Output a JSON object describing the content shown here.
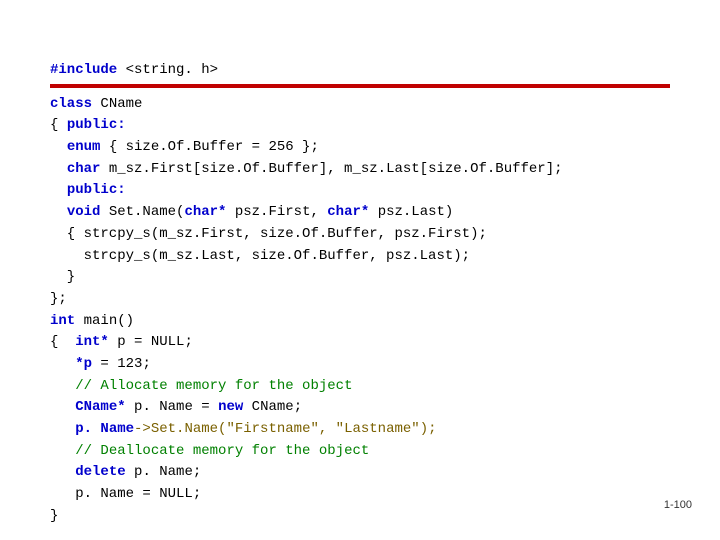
{
  "code": {
    "l01a": "#include",
    "l01b": " <string. h>",
    "l02a": "class",
    "l02b": " CName",
    "l03a": "{ ",
    "l03b": "public:",
    "l04a": "  ",
    "l04b": "enum",
    "l04c": " { size.Of.Buffer = 256 };",
    "l05a": "  ",
    "l05b": "char",
    "l05c": " m_sz.First[size.Of.Buffer], m_sz.Last[size.Of.Buffer];",
    "l06a": "  ",
    "l06b": "public:",
    "l07a": "  ",
    "l07b": "void",
    "l07c": " Set.Name(",
    "l07d": "char*",
    "l07e": " psz.First, ",
    "l07f": "char*",
    "l07g": " psz.Last)",
    "l08": "  { strcpy_s(m_sz.First, size.Of.Buffer, psz.First);",
    "l09": "    strcpy_s(m_sz.Last, size.Of.Buffer, psz.Last);",
    "l10": "  }",
    "l11": "};",
    "l12a": "int",
    "l12b": " main()",
    "l13a": "{  ",
    "l13b": "int*",
    "l13c": " p = NULL;",
    "l14a": "   ",
    "l14b": "*p",
    "l14c": " = 123;",
    "l15a": "   ",
    "l15b": "// Allocate memory for the object",
    "l16a": "   ",
    "l16b": "CName*",
    "l16c": " p. Name = ",
    "l16d": "new",
    "l16e": " CName;",
    "l17a": "   ",
    "l17b": "p. Name",
    "l17c": "->",
    "l17d": "Set.Name(\"Firstname\", \"Lastname\");",
    "l18a": "   ",
    "l18b": "// Deallocate memory for the object",
    "l19a": "   ",
    "l19b": "delete",
    "l19c": " p. Name;",
    "l20": "   p. Name = NULL;",
    "l21": "}"
  },
  "footer": "1-100"
}
